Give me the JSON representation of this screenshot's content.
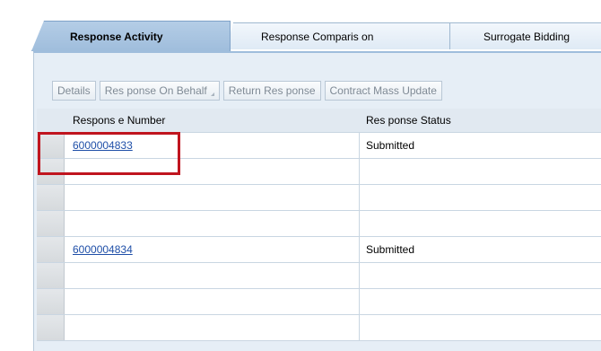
{
  "tabs": [
    {
      "label": "Response Activity",
      "active": true
    },
    {
      "label": "Response Comparis on",
      "active": false
    },
    {
      "label": "Surrogate Bidding",
      "active": false
    }
  ],
  "toolbar": {
    "details_label": "Details",
    "response_on_behalf_label": "Res ponse On Behalf",
    "return_response_label": "Return Res ponse",
    "contract_mass_update_label": "Contract Mass Update"
  },
  "table": {
    "columns": [
      "Respons e Number",
      "Res ponse Status"
    ],
    "rows": [
      {
        "number": "6000004833",
        "status": "Submitted"
      },
      {
        "number": "",
        "status": ""
      },
      {
        "number": "",
        "status": ""
      },
      {
        "number": "",
        "status": ""
      },
      {
        "number": "6000004834",
        "status": "Submitted"
      },
      {
        "number": "",
        "status": ""
      },
      {
        "number": "",
        "status": ""
      },
      {
        "number": "",
        "status": ""
      }
    ]
  },
  "colors": {
    "active_tab": "#a9c5e2",
    "panel_bg": "#e6eef6",
    "link": "#1f4fa8",
    "highlight": "#c0151f"
  }
}
